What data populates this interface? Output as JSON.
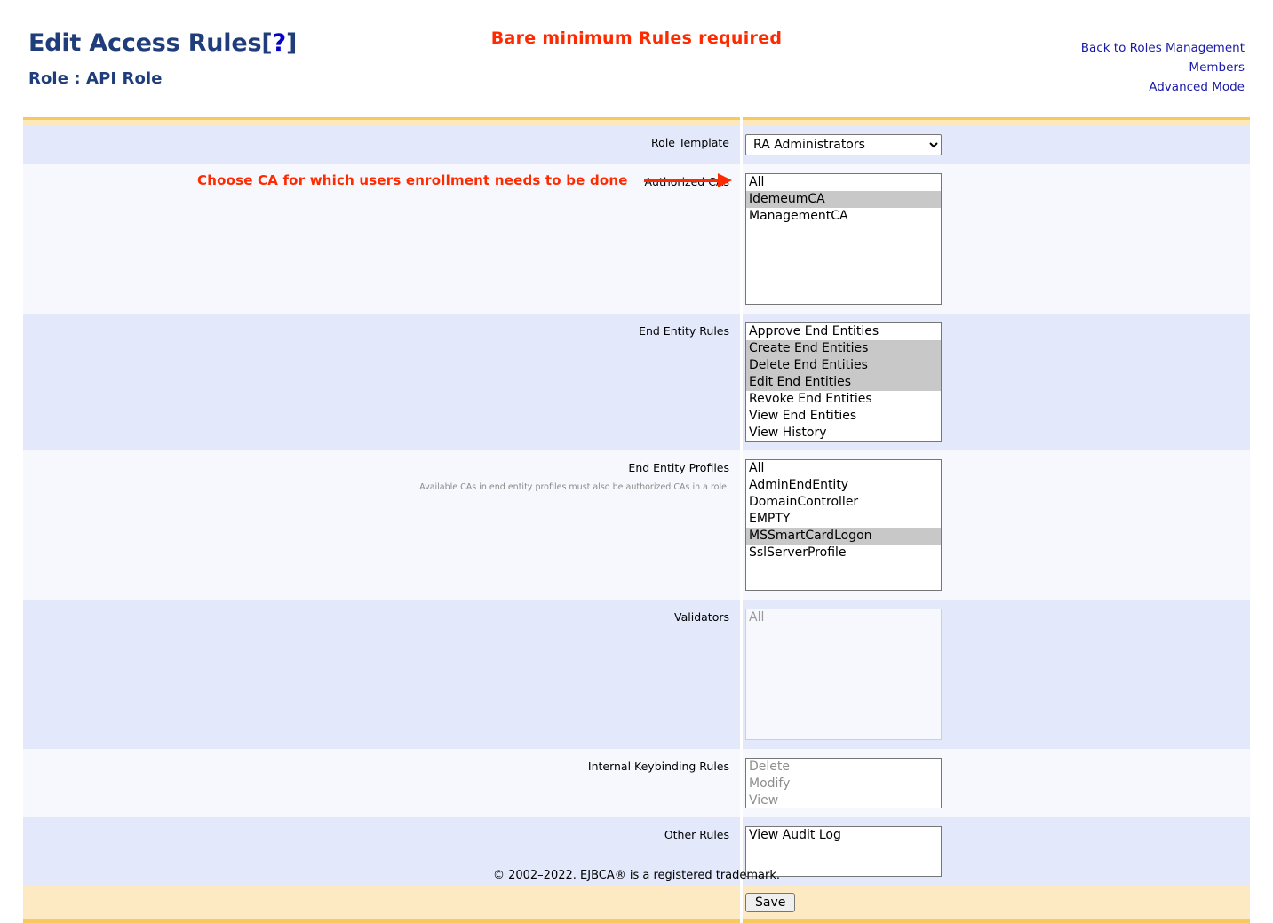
{
  "header": {
    "title_main": "Edit Access Rules",
    "title_bracket_open": "[",
    "title_help": "?",
    "title_bracket_close": "]",
    "role_label": "Role : API Role",
    "banner_note": "Bare minimum Rules required",
    "links": [
      {
        "label": "Back to Roles Management"
      },
      {
        "label": "Members"
      },
      {
        "label": "Advanced Mode"
      }
    ]
  },
  "annotation": {
    "text": "Choose CA for which users enrollment needs to be done",
    "color": "#ff2a00",
    "arrow_icon": "right-arrow-icon"
  },
  "form": {
    "role_template": {
      "label": "Role Template",
      "selected": "RA Administrators",
      "options": [
        "RA Administrators"
      ]
    },
    "authorized_cas": {
      "label": "Authorized CAs",
      "options": [
        {
          "label": "All",
          "selected": false
        },
        {
          "label": "IdemeumCA",
          "selected": true
        },
        {
          "label": "ManagementCA",
          "selected": false
        }
      ]
    },
    "end_entity_rules": {
      "label": "End Entity Rules",
      "options": [
        {
          "label": "Approve End Entities",
          "selected": false
        },
        {
          "label": "Create End Entities",
          "selected": true
        },
        {
          "label": "Delete End Entities",
          "selected": true
        },
        {
          "label": "Edit End Entities",
          "selected": true
        },
        {
          "label": "Revoke End Entities",
          "selected": false
        },
        {
          "label": "View End Entities",
          "selected": false
        },
        {
          "label": "View History",
          "selected": false
        }
      ]
    },
    "end_entity_profiles": {
      "label": "End Entity Profiles",
      "sub_label": "Available CAs in end entity profiles must also be authorized CAs in a role.",
      "options": [
        {
          "label": "All",
          "selected": false
        },
        {
          "label": "AdminEndEntity",
          "selected": false
        },
        {
          "label": "DomainController",
          "selected": false
        },
        {
          "label": "EMPTY",
          "selected": false
        },
        {
          "label": "MSSmartCardLogon",
          "selected": true
        },
        {
          "label": "SslServerProfile",
          "selected": false
        }
      ]
    },
    "validators": {
      "label": "Validators",
      "disabled": true,
      "options": [
        {
          "label": "All",
          "selected": false
        }
      ]
    },
    "internal_keybinding_rules": {
      "label": "Internal Keybinding Rules",
      "options": [
        {
          "label": "Delete",
          "selected": false
        },
        {
          "label": "Modify",
          "selected": false
        },
        {
          "label": "View",
          "selected": false
        }
      ]
    },
    "other_rules": {
      "label": "Other Rules",
      "options": [
        {
          "label": "View Audit Log",
          "selected": false
        }
      ]
    },
    "save_label": "Save"
  },
  "footer": {
    "copyright": "© 2002–2022. EJBCA® is a registered trademark."
  }
}
